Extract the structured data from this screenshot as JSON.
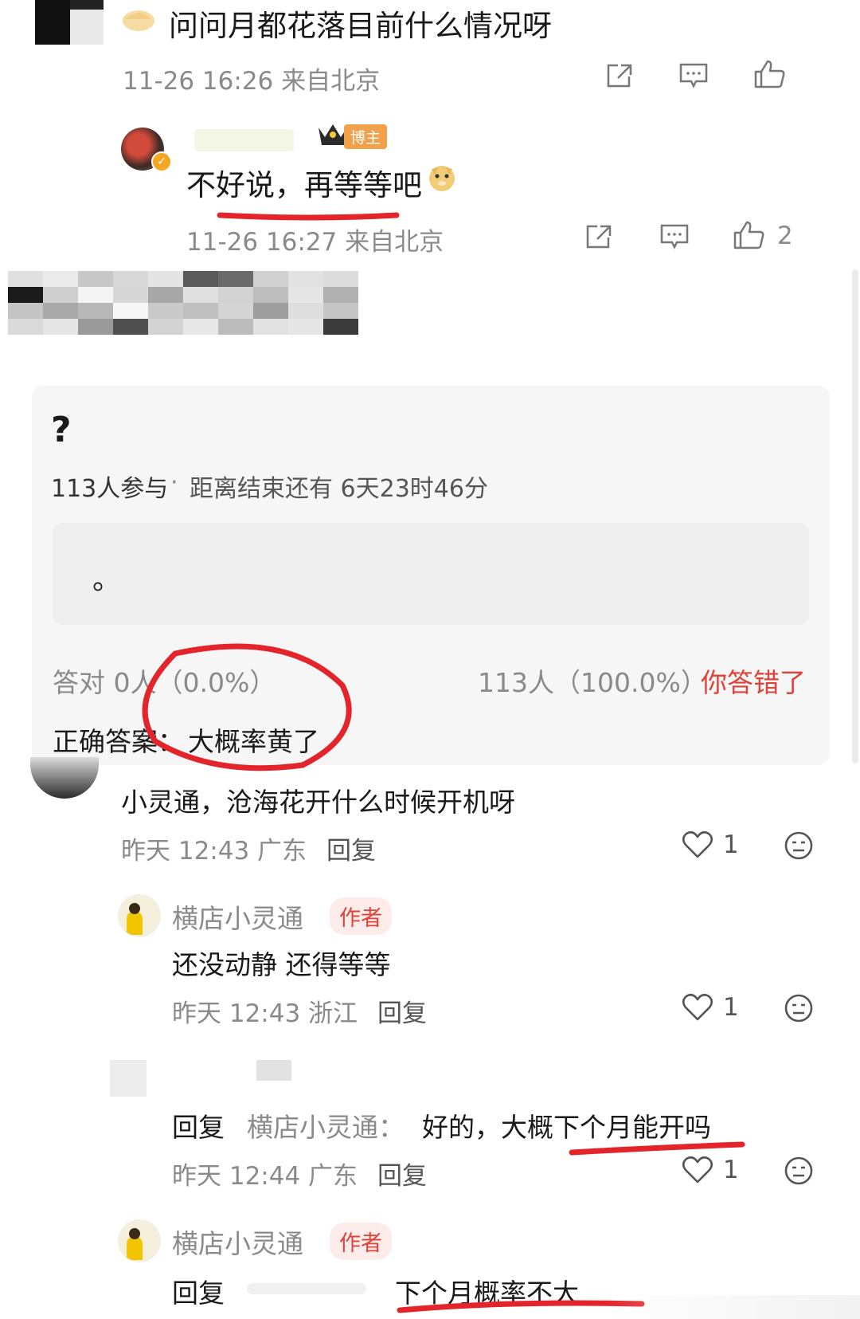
{
  "top_comment": {
    "text": "问问月都花落目前什么情况呀",
    "meta": "11-26 16:26 来自北京"
  },
  "blogger_reply": {
    "badge": "博主",
    "text": "不好说，再等等吧",
    "meta": "11-26 16:27 来自北京",
    "like_count": "2"
  },
  "quiz": {
    "question": "?",
    "participants": "113人参与",
    "dot": "·",
    "countdown": "距离结束还有 6天23时46分",
    "option_text": "。",
    "correct_stat": "答对 0人（0.0%）",
    "wrong_stat": "113人（100.0%）",
    "wrong_label": "你答错了",
    "answer_label": "正确答案：",
    "answer_value": "大概率黄了"
  },
  "comments": [
    {
      "text": "小灵通，沧海花开什么时候开机呀",
      "time_location": "昨天 12:43 广东",
      "reply_label": "回复",
      "like_count": "1"
    },
    {
      "username": "横店小灵通",
      "tag": "作者",
      "text": "还没动静 还得等等",
      "time_location": "昨天 12:43 浙江",
      "reply_label": "回复",
      "like_count": "1"
    },
    {
      "reply_prefix": "回复",
      "reply_to": "横店小灵通：",
      "text": "好的，大概下个月能开吗",
      "time_location": "昨天 12:44 广东",
      "reply_label": "回复",
      "like_count": "1"
    },
    {
      "username": "横店小灵通",
      "tag": "作者",
      "reply_prefix": "回复",
      "text": "下个月概率不大"
    }
  ],
  "colors": {
    "accent_red": "#e0423a",
    "muted_gray": "#8a8a8a",
    "quiz_bg": "#f6f6f6"
  }
}
